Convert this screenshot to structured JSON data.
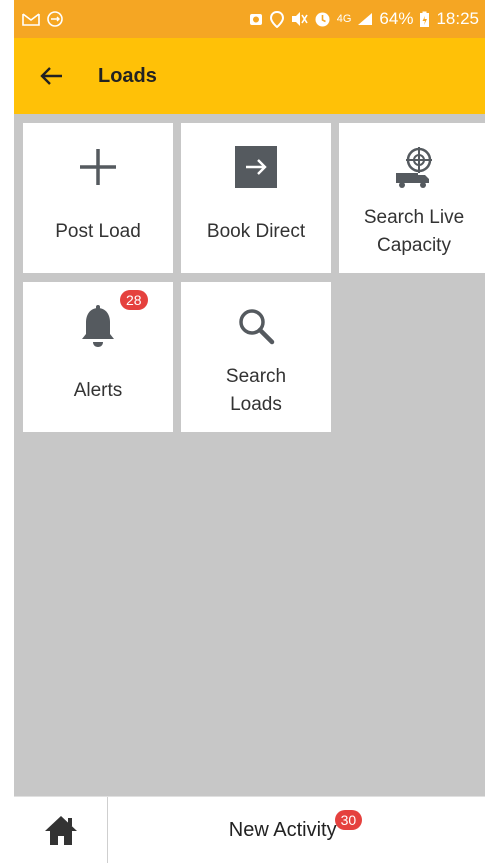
{
  "status_bar": {
    "battery": "64%",
    "time": "18:25",
    "network": "4G",
    "icons": [
      "gmail-icon",
      "sync-icon",
      "alarm-icon",
      "location-icon",
      "mute-icon",
      "clock-icon",
      "signal-icon",
      "battery-icon"
    ]
  },
  "app_bar": {
    "title": "Loads",
    "back_icon": "arrow-left-icon",
    "color": "#ffc107"
  },
  "tiles": [
    {
      "label": "Post Load",
      "icon": "plus-icon"
    },
    {
      "label": "Book Direct",
      "icon": "arrow-right-box-icon"
    },
    {
      "label": "Search Live\nCapacity",
      "icon": "truck-target-icon"
    },
    {
      "label": "Alerts",
      "icon": "bell-icon",
      "badge": "28"
    },
    {
      "label": "Search\nLoads",
      "icon": "search-icon"
    }
  ],
  "bottom_bar": {
    "home_icon": "home-icon",
    "activity_label": "New Activity",
    "activity_badge": "30"
  },
  "colors": {
    "status_bar": "#f5a623",
    "app_bar": "#ffc107",
    "background": "#c7c7c7",
    "badge": "#e5413e",
    "icon": "#555a5f"
  }
}
